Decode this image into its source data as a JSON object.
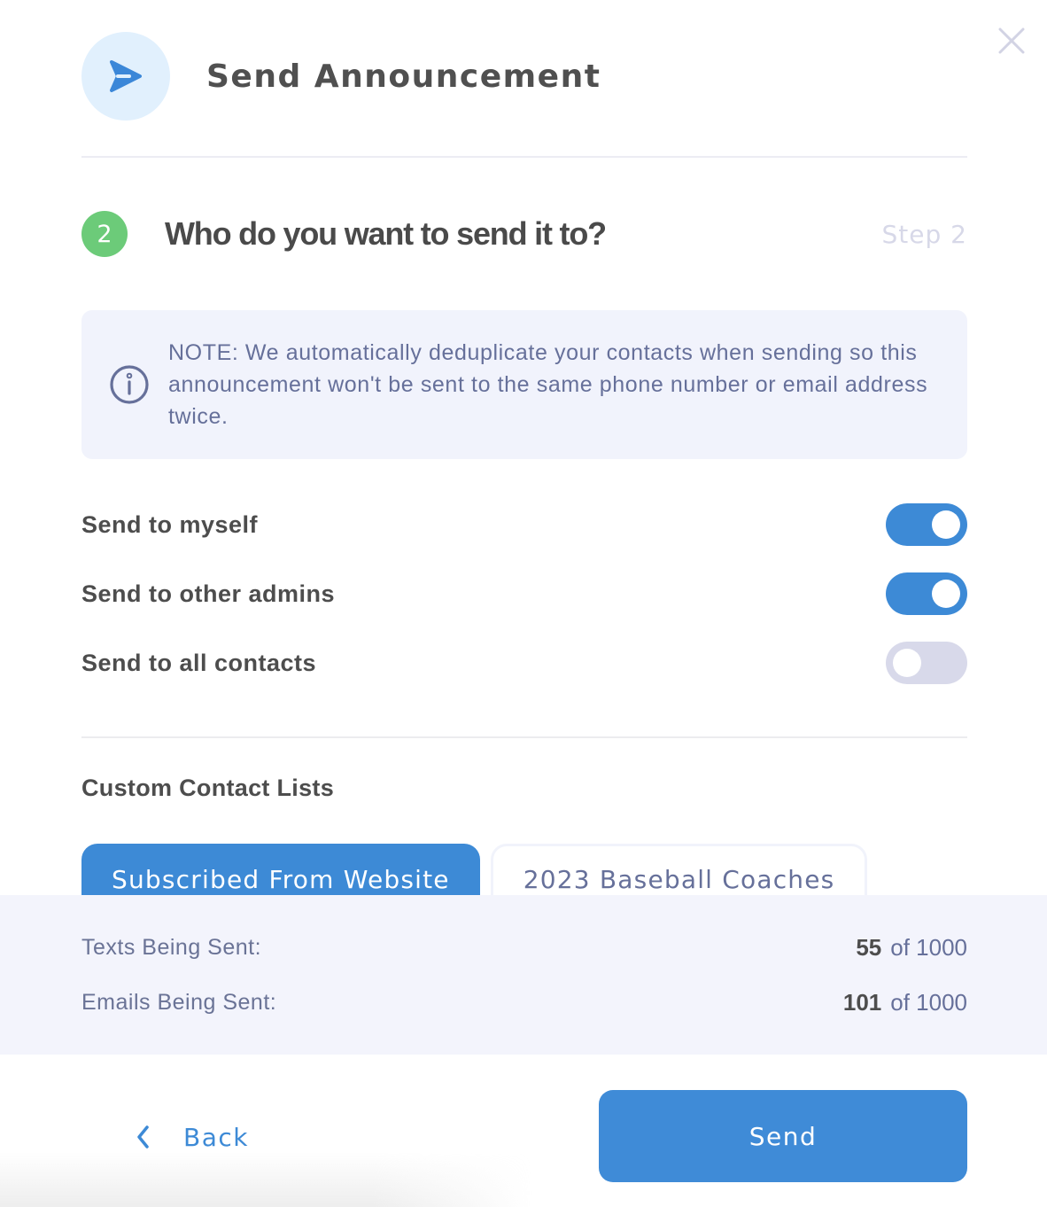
{
  "header": {
    "title": "Send Announcement",
    "icon": "send-arrow-icon",
    "close_icon": "close-icon"
  },
  "step": {
    "number": "2",
    "question": "Who do you want to send it to?",
    "label": "Step 2"
  },
  "note": {
    "icon": "info-icon",
    "text": "NOTE: We automatically deduplicate your contacts when sending so this announcement won't be sent to the same phone number or email address twice."
  },
  "toggles": [
    {
      "label": "Send to myself",
      "on": true
    },
    {
      "label": "Send to other admins",
      "on": true
    },
    {
      "label": "Send to all contacts",
      "on": false
    }
  ],
  "custom_lists": {
    "title": "Custom Contact Lists",
    "items": [
      {
        "label": "Subscribed From Website",
        "selected": true
      },
      {
        "label": "2023 Baseball Coaches",
        "selected": false
      }
    ]
  },
  "summary": {
    "texts": {
      "label": "Texts Being Sent:",
      "count": "55",
      "total": "of 1000"
    },
    "emails": {
      "label": "Emails Being Sent:",
      "count": "101",
      "total": "of 1000"
    }
  },
  "footer": {
    "back_label": "Back",
    "send_label": "Send"
  },
  "colors": {
    "accent": "#3d8ad6",
    "step_badge": "#6ccb79",
    "toggle_off": "#d8d9ea",
    "note_bg": "#f1f3fc"
  }
}
